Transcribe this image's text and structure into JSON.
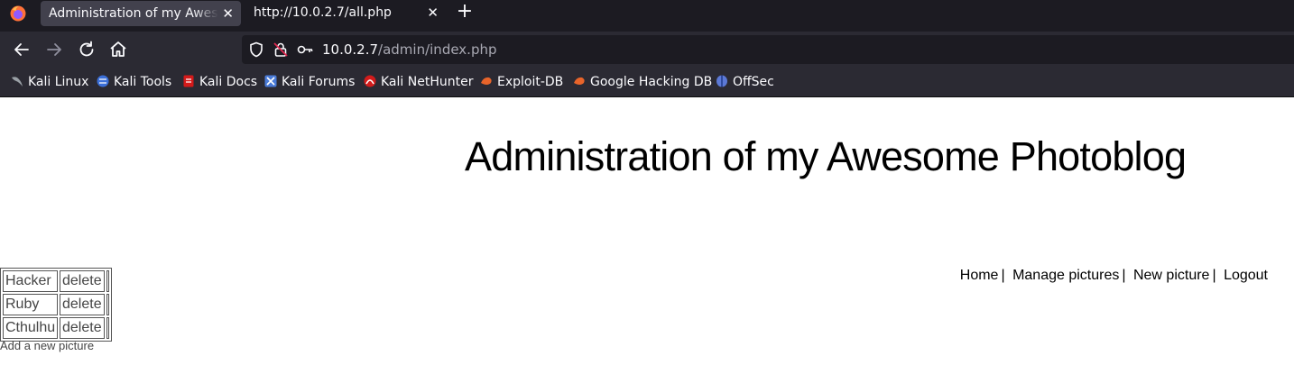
{
  "browser": {
    "tabs": [
      {
        "label": "Administration of my Awesome Photoblog",
        "active": true
      },
      {
        "label": "http://10.0.2.7/all.php",
        "active": false
      }
    ],
    "url": {
      "host": "10.0.2.7",
      "path": "/admin/index.php"
    },
    "bookmarks": [
      {
        "label": "Kali Linux",
        "icon": "kali-dragon-icon",
        "color": "#9aa0a6"
      },
      {
        "label": "Kali Tools",
        "icon": "kali-tools-icon",
        "color": "#3b6fd8"
      },
      {
        "label": "Kali Docs",
        "icon": "kali-docs-icon",
        "color": "#d41a1a"
      },
      {
        "label": "Kali Forums",
        "icon": "kali-forums-icon",
        "color": "#4a7bd8"
      },
      {
        "label": "Kali NetHunter",
        "icon": "nethunter-icon",
        "color": "#d21b1b"
      },
      {
        "label": "Exploit-DB",
        "icon": "exploit-db-icon",
        "color": "#e8642a"
      },
      {
        "label": "Google Hacking DB",
        "icon": "ghdb-icon",
        "color": "#e8642a"
      },
      {
        "label": "OffSec",
        "icon": "offsec-icon",
        "color": "#5c79d6"
      }
    ]
  },
  "page": {
    "title": "Administration of my Awesome Photoblog",
    "menu": [
      {
        "label": "Home"
      },
      {
        "label": "Manage pictures"
      },
      {
        "label": "New picture"
      },
      {
        "label": "Logout"
      }
    ],
    "separator": "|",
    "pictures": [
      {
        "name": "Hacker",
        "action": "delete"
      },
      {
        "name": "Ruby",
        "action": "delete"
      },
      {
        "name": "Cthulhu",
        "action": "delete"
      }
    ],
    "add_link": "Add a new picture"
  }
}
